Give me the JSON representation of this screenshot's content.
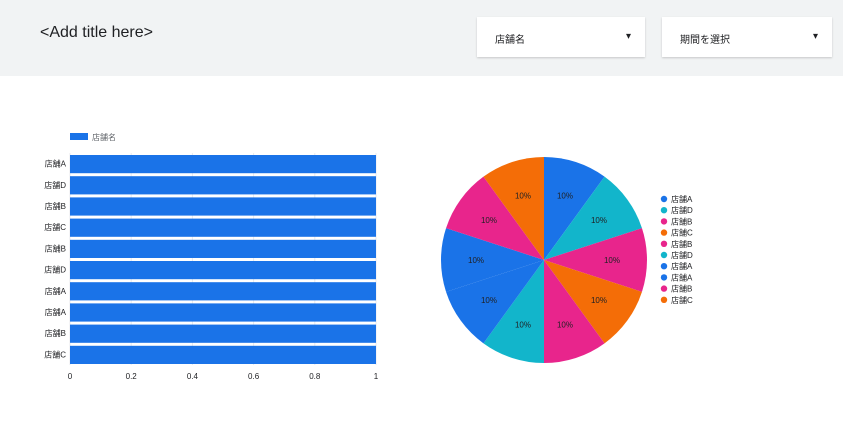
{
  "page": {
    "title": "<Add title here>"
  },
  "filters": {
    "store": {
      "label": "店舗名",
      "arrow": "▼"
    },
    "period": {
      "label": "期間を選択",
      "arrow": "▼"
    }
  },
  "chart_data": [
    {
      "type": "bar",
      "orientation": "horizontal",
      "categories": [
        "店舗A",
        "店舗D",
        "店舗B",
        "店舗C",
        "店舗B",
        "店舗D",
        "店舗A",
        "店舗A",
        "店舗B",
        "店舗C"
      ],
      "series": [
        {
          "name": "店舗名",
          "values": [
            1,
            1,
            1,
            1,
            1,
            1,
            1,
            1,
            1,
            1
          ]
        }
      ],
      "x_ticks": [
        "0",
        "0.2",
        "0.4",
        "0.6",
        "0.8",
        "1"
      ],
      "xlim": [
        0,
        1
      ],
      "legend_position": "top-left",
      "color": "#1a73e8"
    },
    {
      "type": "pie",
      "labels": [
        "店舗A",
        "店舗D",
        "店舗B",
        "店舗C",
        "店舗B",
        "店舗D",
        "店舗A",
        "店舗A",
        "店舗B",
        "店舗C"
      ],
      "values": [
        10,
        10,
        10,
        10,
        10,
        10,
        10,
        10,
        10,
        10
      ],
      "slice_labels": [
        "10%",
        "10%",
        "10%",
        "10%",
        "10%",
        "10%",
        "10%",
        "10%",
        "10%",
        "10%"
      ],
      "colors": [
        "#1a73e8",
        "#12b5cb",
        "#e8258c",
        "#f46d07",
        "#e8258c",
        "#12b5cb",
        "#1a73e8",
        "#1a73e8",
        "#e8258c",
        "#f46d07"
      ],
      "legend_position": "right"
    }
  ]
}
